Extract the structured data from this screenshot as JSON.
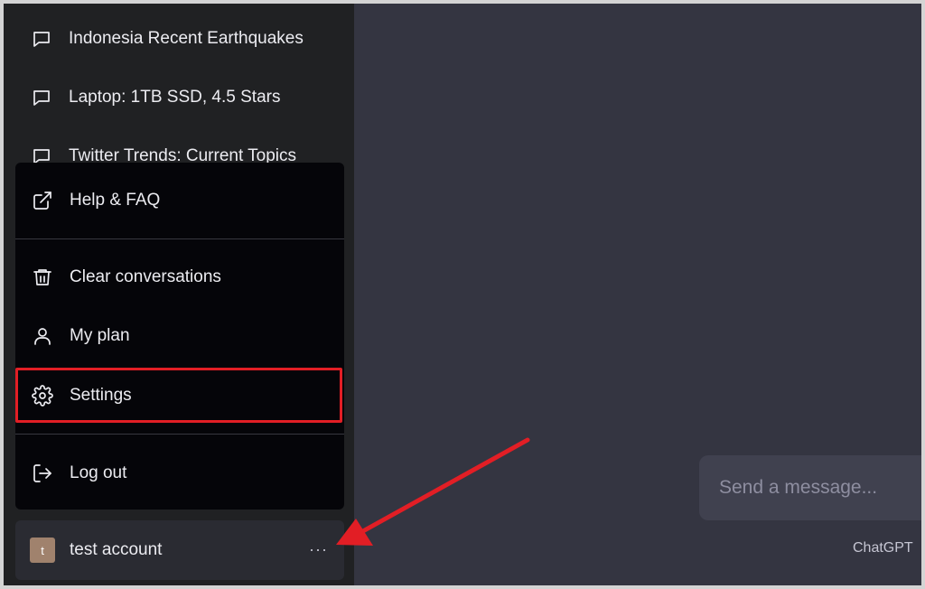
{
  "sidebar": {
    "conversations": [
      {
        "label": "Indonesia Recent Earthquakes",
        "icon": "chat-bubble-icon"
      },
      {
        "label": "Laptop: 1TB SSD, 4.5 Stars",
        "icon": "chat-bubble-icon"
      },
      {
        "label": "Twitter Trends: Current Topics",
        "icon": "chat-bubble-icon"
      }
    ]
  },
  "menu": {
    "help": {
      "label": "Help & FAQ",
      "icon": "external-link-icon"
    },
    "clear": {
      "label": "Clear conversations",
      "icon": "trash-icon"
    },
    "plan": {
      "label": "My plan",
      "icon": "user-icon"
    },
    "settings": {
      "label": "Settings",
      "icon": "gear-icon"
    },
    "logout": {
      "label": "Log out",
      "icon": "logout-icon"
    }
  },
  "account": {
    "avatar_initial": "t",
    "name": "test account",
    "more": "···"
  },
  "composer": {
    "placeholder": "Send a message..."
  },
  "footer": {
    "text": "ChatGPT"
  },
  "colors": {
    "highlight": "#e21e25",
    "annotation_arrow": "#e21e25",
    "sidebar_bg": "#202123",
    "main_bg": "#343541"
  }
}
